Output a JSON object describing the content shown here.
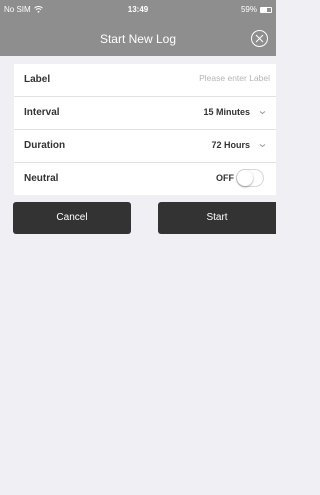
{
  "status_bar": {
    "carrier": "No SIM",
    "time": "13:49",
    "battery_percent_label": "59%",
    "battery_level": 0.59
  },
  "header": {
    "title": "Start New Log",
    "close_icon": "close-circle-icon"
  },
  "form": {
    "label": {
      "label": "Label",
      "placeholder": "Please enter Label"
    },
    "interval": {
      "label": "Interval",
      "value": "15 Minutes"
    },
    "duration": {
      "label": "Duration",
      "value": "72 Hours"
    },
    "neutral": {
      "label": "Neutral",
      "value": "OFF",
      "enabled": false
    }
  },
  "actions": {
    "cancel_label": "Cancel",
    "start_label": "Start"
  },
  "colors": {
    "header_bg": "#8e8e8e",
    "page_bg": "#efeff4",
    "button_bg": "#333333"
  }
}
